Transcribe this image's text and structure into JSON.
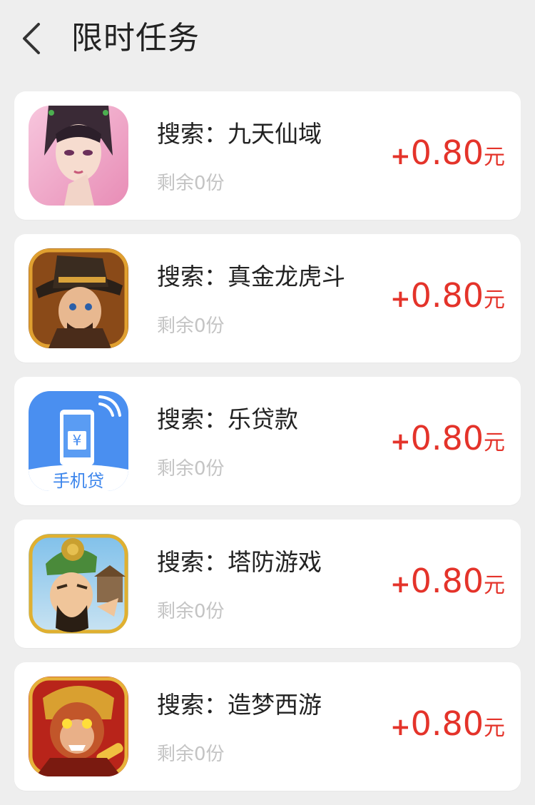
{
  "header": {
    "title": "限时任务"
  },
  "tasks": [
    {
      "icon": "game-icon-jiutian-xianyu",
      "title": "搜索：九天仙域",
      "remaining": "剩余0份",
      "plus": "+",
      "amount": "0.80",
      "unit": "元"
    },
    {
      "icon": "game-icon-zhenjin-longhudou",
      "title": "搜索：真金龙虎斗",
      "remaining": "剩余0份",
      "plus": "+",
      "amount": "0.80",
      "unit": "元"
    },
    {
      "icon": "app-icon-shoujidai",
      "icon_label": "手机贷",
      "icon_symbol": "¥",
      "title": "搜索：乐贷款",
      "remaining": "剩余0份",
      "plus": "+",
      "amount": "0.80",
      "unit": "元"
    },
    {
      "icon": "game-icon-tafang-youxi",
      "title": "搜索：塔防游戏",
      "remaining": "剩余0份",
      "plus": "+",
      "amount": "0.80",
      "unit": "元"
    },
    {
      "icon": "game-icon-zaomeng-xiyou",
      "title": "搜索：造梦西游",
      "remaining": "剩余0份",
      "plus": "+",
      "amount": "0.80",
      "unit": "元"
    }
  ],
  "colors": {
    "background": "#eeeeee",
    "card": "#ffffff",
    "reward": "#e4332a",
    "remaining": "#c4c4c4",
    "title": "#222222"
  }
}
